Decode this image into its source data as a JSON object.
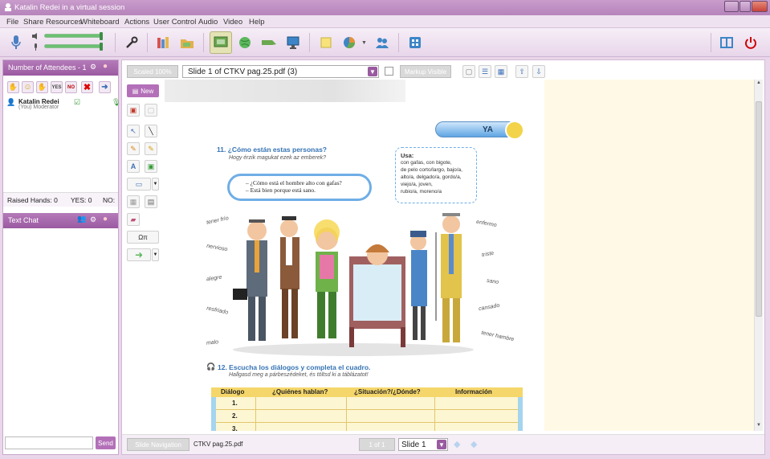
{
  "window": {
    "title": "Katalin Redei in a virtual session"
  },
  "menu": [
    "File",
    "Share Resources",
    "Whiteboard",
    "Actions",
    "User Control",
    "Audio",
    "Video",
    "Help"
  ],
  "attendees": {
    "header": "Number of Attendees - 1",
    "status_buttons": [
      "YES",
      "NO"
    ],
    "user_name": "Katalin Redei",
    "user_role": "(You) Moderator",
    "raised_hands": "Raised Hands: 0",
    "yes_count": "YES: 0",
    "no_label": "NO:"
  },
  "chat": {
    "header": "Text Chat",
    "send_label": "Send"
  },
  "slide_toolbar": {
    "scaled_label": "Scaled 100%",
    "slide_title": "Slide 1 of CTKV pag.25.pdf (3)",
    "markup_label": "Markup Visible",
    "new_label": "New",
    "special_chars": "Ωπ"
  },
  "bottom_bar": {
    "nav_label": "Slide Navigation",
    "filename": "CTKV pag.25.pdf",
    "page_indicator": "1 of 1",
    "slide_select": "Slide 1"
  },
  "page": {
    "badge": "YA",
    "ex11_title": "11. ¿Cómo están estas personas?",
    "ex11_sub": "Hogy érzik magukat ezek az emberek?",
    "bubble_line1": "– ¿Cómo está el hombre alto con gafas?",
    "bubble_line2": "– Está bien porque está sano.",
    "usa_title": "Usa:",
    "usa_lines": [
      "con gafas, con bigote,",
      "de pelo corto/largo, bajo/a,",
      "alto/a, delgado/a, gordo/a,",
      "viejo/a, joven,",
      "rubio/a, moreno/a"
    ],
    "left_words": [
      "tener frío",
      "nervioso",
      "alegre",
      "resfriado",
      "malo"
    ],
    "right_words": [
      "enfermo",
      "triste",
      "sano",
      "cansado",
      "tener hambre"
    ],
    "ex12_title": "12. Escucha los diálogos y completa el cuadro.",
    "ex12_sub": "Hallgasd meg a párbeszédeket, és töltsd ki a táblázatot!",
    "table_headers": [
      "Diálogo",
      "¿Quiénes hablan?",
      "¿Situación?/¿Dónde?",
      "Información"
    ],
    "table_rows": [
      "1.",
      "2.",
      "3."
    ]
  }
}
